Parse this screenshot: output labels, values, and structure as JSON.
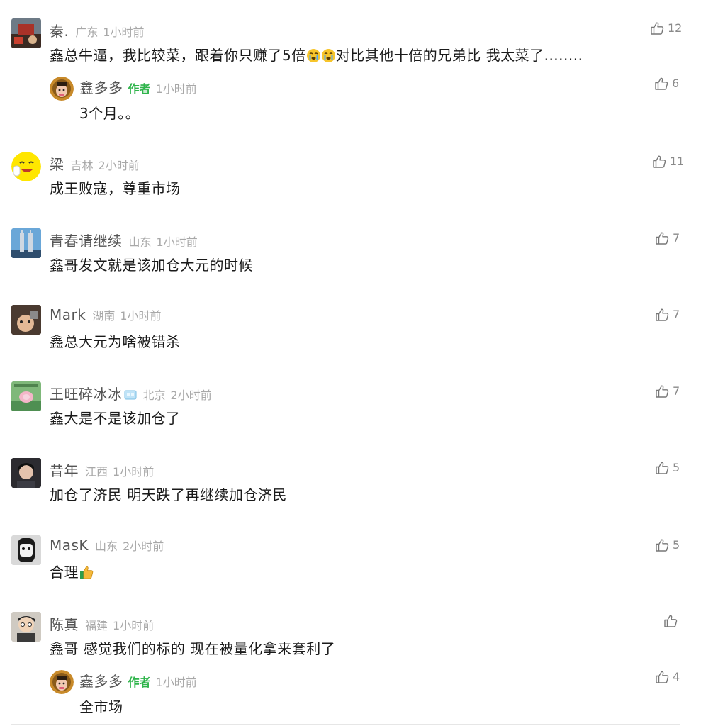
{
  "like_icon": "thumbs-up-outline-icon",
  "colors": {
    "author_badge": "#2fb44b",
    "meta": "#a8a8a8",
    "text": "#1a1a1a"
  },
  "comments": [
    {
      "user": "秦.",
      "region": "广东",
      "time": "1小时前",
      "text_before_emoji": "鑫总牛逼，我比较菜，跟着你只赚了5倍",
      "emojis": [
        "crying-face-emoji",
        "crying-face-emoji"
      ],
      "text_after_emoji": "对比其他十倍的兄弟比  我太菜了........",
      "likes": "12",
      "reply": {
        "user": "鑫多多",
        "badge": "作者",
        "time": "1小时前",
        "text": "3个月。。",
        "likes": "6"
      }
    },
    {
      "user": "梁",
      "region": "吉林",
      "time": "2小时前",
      "text": "成王败寇，尊重市场",
      "likes": "11"
    },
    {
      "user": "青春请继续",
      "region": "山东",
      "time": "1小时前",
      "text": "鑫哥发文就是该加仓大元的时候",
      "likes": "7"
    },
    {
      "user": "Mark",
      "region": "湖南",
      "time": "1小时前",
      "text": "鑫总大元为啥被错杀",
      "likes": "7"
    },
    {
      "user": "王旺碎冰冰",
      "user_emoji": "ice-cube-emoji",
      "region": "北京",
      "time": "2小时前",
      "text": "鑫大是不是该加仓了",
      "likes": "7"
    },
    {
      "user": "昔年",
      "region": "江西",
      "time": "1小时前",
      "text": "加仓了济民 明天跌了再继续加仓济民",
      "likes": "5"
    },
    {
      "user": "MasK",
      "region": "山东",
      "time": "2小时前",
      "text": "合理",
      "text_emoji": "thumbs-up-emoji",
      "likes": "5"
    },
    {
      "user": "陈真",
      "region": "福建",
      "time": "1小时前",
      "text": "鑫哥 感觉我们的标的 现在被量化拿来套利了",
      "likes": "",
      "reply": {
        "user": "鑫多多",
        "badge": "作者",
        "time": "1小时前",
        "text": "全市场",
        "likes": "4"
      }
    }
  ]
}
